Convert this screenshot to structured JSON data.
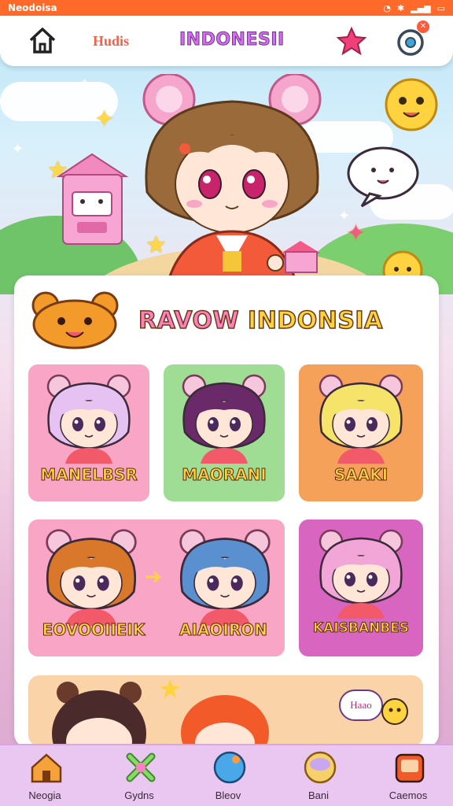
{
  "status_bar": {
    "left_text": "Neodoisa",
    "icons": [
      "wifi-icon",
      "battery-icon",
      "bluetooth-icon",
      "signal-icon"
    ]
  },
  "top_nav": {
    "link_label": "Hudis",
    "title": "INDONESII",
    "icons": [
      "home-icon",
      "star-icon",
      "profile-icon"
    ],
    "notification_mark": "✕"
  },
  "section": {
    "title_part1": "RAVOW",
    "title_part2": "INDONSIA",
    "icon": "bear-icon"
  },
  "characters": [
    {
      "name": "MANELBSR",
      "bg": "#f8a5c6",
      "hair": "#e6c2f2"
    },
    {
      "name": "MAORANI",
      "bg": "#9fdd94",
      "hair": "#6a2a6a"
    },
    {
      "name": "SAAKI",
      "bg": "#f6a15a",
      "hair": "#f6e46a"
    },
    {
      "name": "EOVOOIIEIK",
      "bg": "#f8a5c6",
      "hair": "#d9772a"
    },
    {
      "name": "AIAOIRON",
      "bg": "#f8a5c6",
      "hair": "#5a8fd0"
    },
    {
      "name": "KAISBANBES",
      "bg": "#d866c0",
      "hair": "#f2a6d8"
    }
  ],
  "hero_bubble_text": "Haao",
  "bottom_nav": [
    {
      "label": "Neogia",
      "icon": "home-icon"
    },
    {
      "label": "Gydns",
      "icon": "cross-icon"
    },
    {
      "label": "Bleov",
      "icon": "globe-icon"
    },
    {
      "label": "Bani",
      "icon": "orb-icon"
    },
    {
      "label": "Caemos",
      "icon": "game-icon"
    }
  ],
  "colors": {
    "accent": "#ff6a2b",
    "title_pink": "#d96bf0",
    "label_yellow": "#ffd23f"
  }
}
